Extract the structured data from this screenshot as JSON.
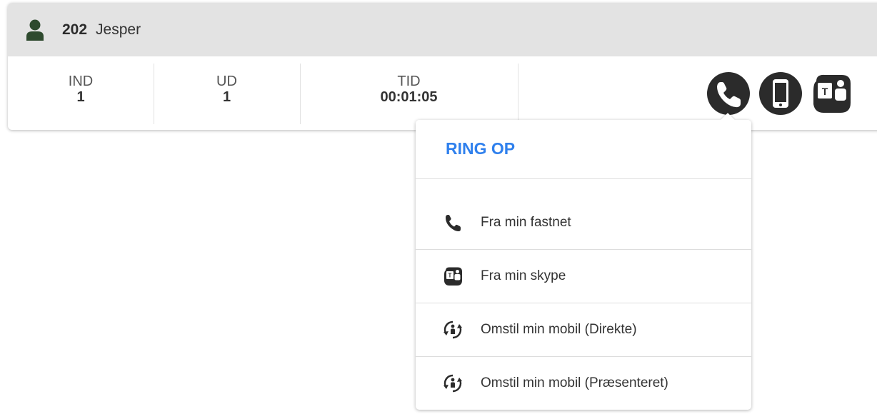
{
  "user": {
    "extension": "202",
    "name": "Jesper"
  },
  "stats": [
    {
      "label": "IND",
      "value": "1"
    },
    {
      "label": "UD",
      "value": "1"
    },
    {
      "label": "TID",
      "value": "00:01:05"
    }
  ],
  "actions": {
    "icons": [
      "phone-icon",
      "mobile-icon",
      "teams-icon"
    ]
  },
  "dropdown": {
    "title": "RING OP",
    "items": [
      {
        "label": "Fra min fastnet",
        "icon": "phone-icon"
      },
      {
        "label": "Fra min skype",
        "icon": "teams-icon"
      },
      {
        "label": "Omstil min mobil (Direkte)",
        "icon": "transfer-icon"
      },
      {
        "label": "Omstil min mobil (Præsenteret)",
        "icon": "transfer-icon"
      }
    ]
  },
  "colors": {
    "accent": "#2f80ed",
    "header_bg": "#e3e3e3",
    "user_icon": "#2e4a2e",
    "icon_dark": "#2b2b2b"
  }
}
